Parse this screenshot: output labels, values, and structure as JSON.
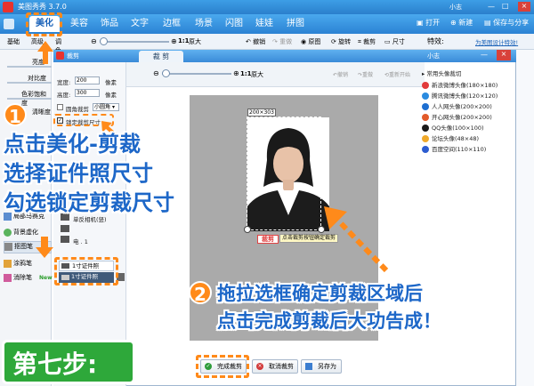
{
  "app": {
    "title": "美图秀秀 3.7.0",
    "user": "小志",
    "open": "打开",
    "new": "新建",
    "save_share": "保存与分享"
  },
  "tabs": [
    {
      "label": "美化"
    },
    {
      "label": "美容"
    },
    {
      "label": "饰品"
    },
    {
      "label": "文字"
    },
    {
      "label": "边框"
    },
    {
      "label": "场景"
    },
    {
      "label": "闪图"
    },
    {
      "label": "娃娃"
    },
    {
      "label": "拼图"
    }
  ],
  "toolbar": {
    "zoom": "1:1",
    "orig": "原大",
    "undo": "撤销",
    "redo": "重做",
    "original": "原图",
    "rotate": "旋转",
    "crop": "裁剪",
    "size": "尺寸",
    "special": "特效:",
    "vote": "为美图设计特效!"
  },
  "leftpanel": {
    "tab_basic": "基础",
    "tab_advanced": "高级",
    "tab_tone": "调色",
    "labels": [
      "亮度",
      "对比度",
      "色彩饱和度",
      "清晰度"
    ],
    "tools": [
      "局部马赛克",
      "背景虚化",
      "抠图笔",
      "涂鸦笔",
      "消除笔"
    ],
    "new_badge": "New"
  },
  "dialog": {
    "title": "裁剪",
    "tab": "裁 剪",
    "user": "小志",
    "width_label": "宽度:",
    "width_value": "200",
    "height_label": "高度:",
    "height_value": "300",
    "unit": "像素",
    "round_corner": "圆角裁剪",
    "round_select": "小圆角",
    "lock_size": "锁定裁剪尺寸",
    "undo": "撤销",
    "redo": "重做",
    "reset": "重新开始",
    "presets": [
      "单反相机(竖)",
      "1寸证件照",
      "1寸证件照"
    ],
    "size_label": "200×303",
    "crop_btn": "裁剪",
    "tooltip": "点击裁剪按钮确定裁剪",
    "finish": "完成裁剪",
    "cancel": "取消裁剪",
    "saveas": "另存为"
  },
  "rightlist": {
    "header": "常用头像裁切",
    "items": [
      "新浪微博头像(180×180)",
      "腾讯微博头像(120×120)",
      "人人网头像(200×200)",
      "开心网头像(200×200)",
      "QQ头像(100×100)",
      "论坛头像(48×48)",
      "百度空间(110×110)"
    ],
    "colors": [
      "#e23b3b",
      "#2a8be0",
      "#1e6fd1",
      "#e25a2a",
      "#1a1a1a",
      "#f0a92a",
      "#2c5cd0"
    ]
  },
  "annotations": {
    "step1_num": "1",
    "step1_lines": [
      "点击美化-剪裁",
      "选择证件照尺寸",
      "勾选锁定剪裁尺寸"
    ],
    "step2_num": "2",
    "step2_lines": [
      "拖拉选框确定剪裁区域后",
      "点击完成剪裁后大功告成！"
    ],
    "step_label": "第七步:"
  }
}
